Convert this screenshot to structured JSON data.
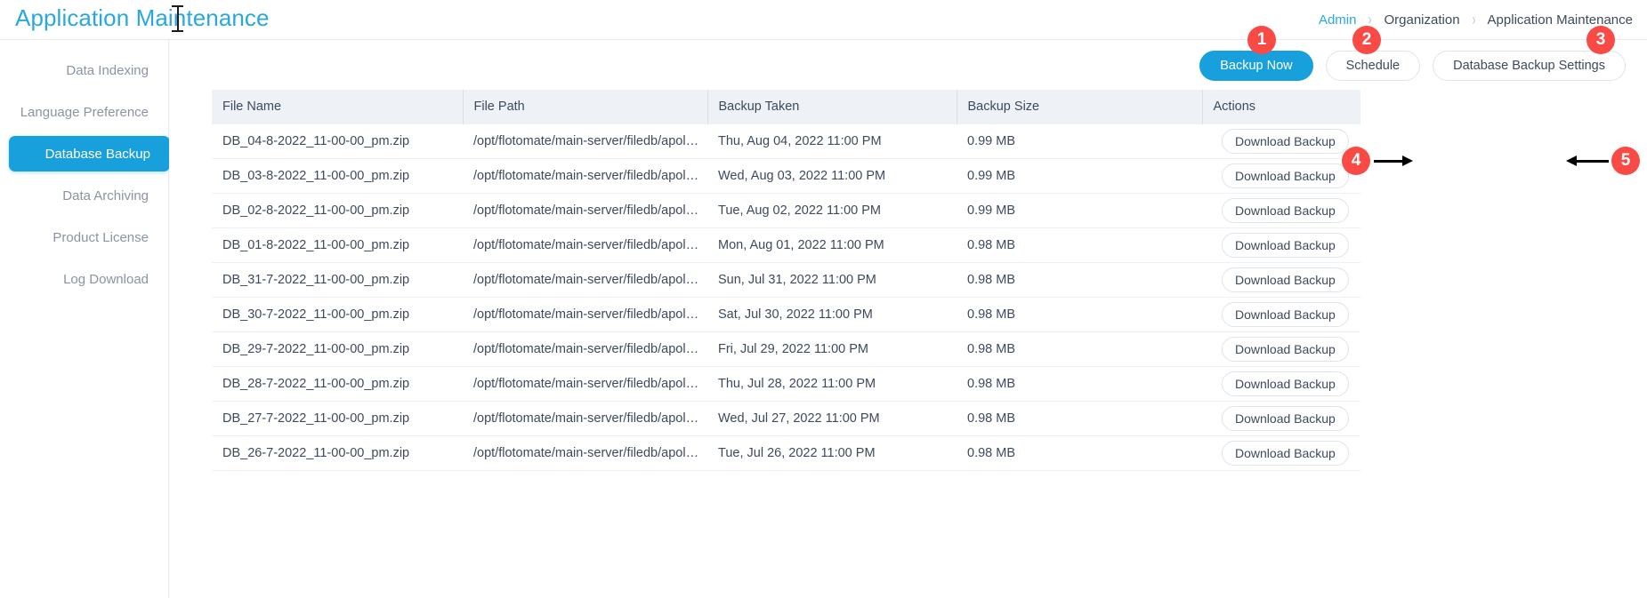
{
  "header": {
    "title": "Application Maintenance",
    "breadcrumb": [
      {
        "label": "Admin",
        "link": true
      },
      {
        "label": "Organization",
        "link": false
      },
      {
        "label": "Application Maintenance",
        "link": false
      }
    ],
    "separator": "›"
  },
  "sidebar": {
    "items": [
      {
        "label": "Data Indexing",
        "active": false
      },
      {
        "label": "Language Preference",
        "active": false
      },
      {
        "label": "Database Backup",
        "active": true
      },
      {
        "label": "Data Archiving",
        "active": false
      },
      {
        "label": "Product License",
        "active": false
      },
      {
        "label": "Log Download",
        "active": false
      }
    ]
  },
  "toolbar": {
    "backup_now": "Backup Now",
    "schedule": "Schedule",
    "settings": "Database Backup Settings"
  },
  "table": {
    "columns": [
      "File Name",
      "File Path",
      "Backup Taken",
      "Backup Size",
      "Actions"
    ],
    "download_label": "Download Backup",
    "delete_icon": "trash-icon",
    "rows": [
      {
        "file_name": "DB_04-8-2022_11-00-00_pm.zip",
        "file_path": "/opt/flotomate/main-server/filedb/apol…",
        "backup_taken": "Thu, Aug 04, 2022 11:00 PM",
        "backup_size": "0.99 MB"
      },
      {
        "file_name": "DB_03-8-2022_11-00-00_pm.zip",
        "file_path": "/opt/flotomate/main-server/filedb/apol…",
        "backup_taken": "Wed, Aug 03, 2022 11:00 PM",
        "backup_size": "0.99 MB"
      },
      {
        "file_name": "DB_02-8-2022_11-00-00_pm.zip",
        "file_path": "/opt/flotomate/main-server/filedb/apol…",
        "backup_taken": "Tue, Aug 02, 2022 11:00 PM",
        "backup_size": "0.99 MB"
      },
      {
        "file_name": "DB_01-8-2022_11-00-00_pm.zip",
        "file_path": "/opt/flotomate/main-server/filedb/apol…",
        "backup_taken": "Mon, Aug 01, 2022 11:00 PM",
        "backup_size": "0.98 MB"
      },
      {
        "file_name": "DB_31-7-2022_11-00-00_pm.zip",
        "file_path": "/opt/flotomate/main-server/filedb/apol…",
        "backup_taken": "Sun, Jul 31, 2022 11:00 PM",
        "backup_size": "0.98 MB"
      },
      {
        "file_name": "DB_30-7-2022_11-00-00_pm.zip",
        "file_path": "/opt/flotomate/main-server/filedb/apol…",
        "backup_taken": "Sat, Jul 30, 2022 11:00 PM",
        "backup_size": "0.98 MB"
      },
      {
        "file_name": "DB_29-7-2022_11-00-00_pm.zip",
        "file_path": "/opt/flotomate/main-server/filedb/apol…",
        "backup_taken": "Fri, Jul 29, 2022 11:00 PM",
        "backup_size": "0.98 MB"
      },
      {
        "file_name": "DB_28-7-2022_11-00-00_pm.zip",
        "file_path": "/opt/flotomate/main-server/filedb/apol…",
        "backup_taken": "Thu, Jul 28, 2022 11:00 PM",
        "backup_size": "0.98 MB"
      },
      {
        "file_name": "DB_27-7-2022_11-00-00_pm.zip",
        "file_path": "/opt/flotomate/main-server/filedb/apol…",
        "backup_taken": "Wed, Jul 27, 2022 11:00 PM",
        "backup_size": "0.98 MB"
      },
      {
        "file_name": "DB_26-7-2022_11-00-00_pm.zip",
        "file_path": "/opt/flotomate/main-server/filedb/apol…",
        "backup_taken": "Tue, Jul 26, 2022 11:00 PM",
        "backup_size": "0.98 MB"
      }
    ]
  },
  "callouts": [
    {
      "number": "1"
    },
    {
      "number": "2"
    },
    {
      "number": "3"
    },
    {
      "number": "4"
    },
    {
      "number": "5"
    }
  ],
  "colors": {
    "accent": "#18a0dd",
    "title": "#29a8e0",
    "callout": "#f94a46",
    "danger": "#f9564f",
    "header_bg": "#eef2f7"
  }
}
